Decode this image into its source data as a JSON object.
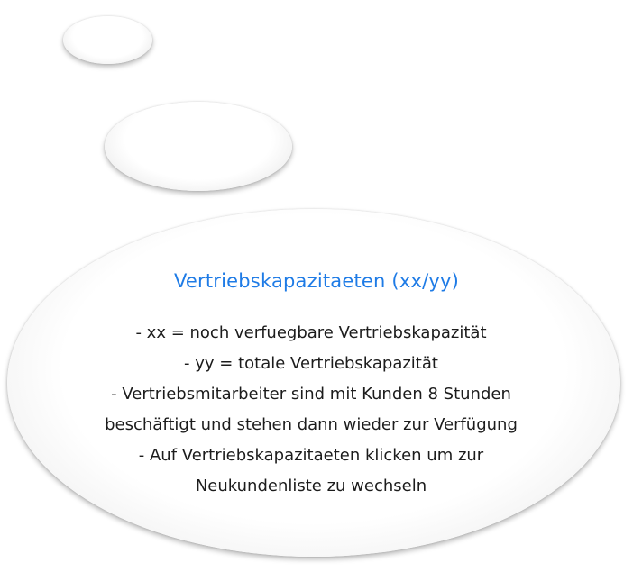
{
  "tooltip": {
    "title": "Vertriebskapazitaeten (xx/yy)",
    "lines": [
      "- xx = noch verfuegbare Vertriebskapazität",
      "- yy = totale Vertriebskapazität",
      "- Vertriebsmitarbeiter sind mit Kunden 8 Stunden",
      "beschäftigt und stehen dann wieder zur Verfügung",
      "- Auf Vertriebskapazitaeten klicken um zur",
      "Neukundenliste zu wechseln"
    ]
  },
  "colors": {
    "title": "#1e7be6",
    "body_text": "#1c1c1c",
    "bubble": "#ffffff"
  }
}
